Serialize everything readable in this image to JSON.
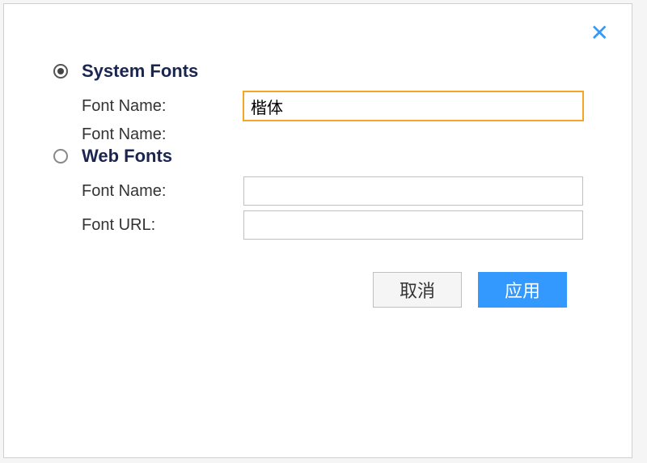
{
  "sections": {
    "system": {
      "title": "System Fonts",
      "selected": true,
      "fields": {
        "font_name_label": "Font Name:",
        "font_name_value": "楷体",
        "font_name2_label": "Font Name:"
      }
    },
    "web": {
      "title": "Web Fonts",
      "selected": false,
      "fields": {
        "font_name_label": "Font Name:",
        "font_name_value": "",
        "font_url_label": "Font URL:",
        "font_url_value": ""
      }
    }
  },
  "buttons": {
    "cancel": "取消",
    "apply": "应用"
  }
}
